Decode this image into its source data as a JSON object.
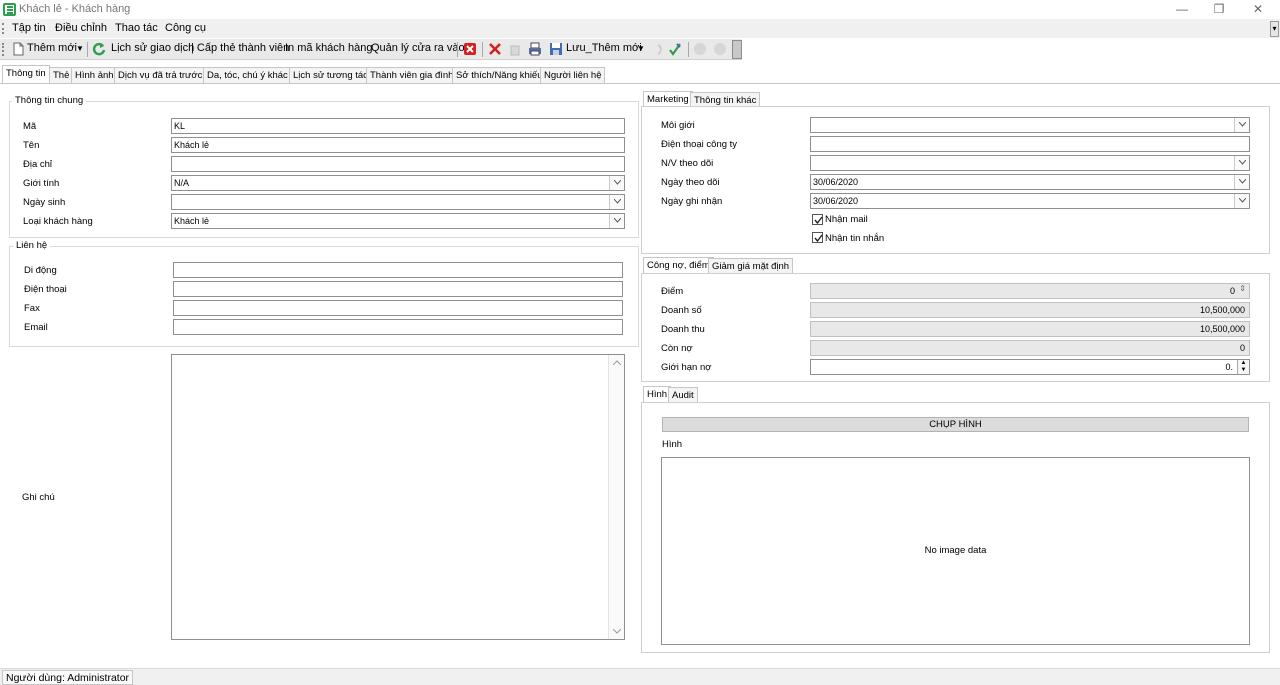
{
  "window": {
    "title": "Khách lẻ - Khách hàng",
    "minimize": "—",
    "restore": "❐",
    "close": "✕"
  },
  "menu": [
    "Tập tin",
    "Điều chỉnh",
    "Thao tác",
    "Công cụ"
  ],
  "toolbar": {
    "new": "Thêm mới",
    "history": "Lịch sử giao dịch",
    "issue_card": "| Cấp thẻ thành viên",
    "print_code": "In mã khách hàng",
    "door_manage": "Quản lý cửa ra vào",
    "save_new": "Lưu_Thêm mới"
  },
  "tabs": [
    "Thông tin",
    "Thẻ",
    "Hình ảnh",
    "Dịch vụ đã trả trước",
    "Da, tóc, chú ý khác",
    "Lịch sử tương tác",
    "Thành viên gia đình",
    "Sở thích/Năng khiếu",
    "Người liên hệ"
  ],
  "general": {
    "title": "Thông tin chung",
    "code_label": "Mã",
    "code": "KL",
    "name_label": "Tên",
    "name": "Khách lẻ",
    "address_label": "Địa chỉ",
    "address": "",
    "gender_label": "Giới tính",
    "gender": "N/A",
    "birth_label": "Ngày sinh",
    "birth": "",
    "type_label": "Loại khách hàng",
    "type": "Khách lẻ"
  },
  "contact": {
    "title": "Liên hệ",
    "mobile_label": "Di động",
    "phone_label": "Điện thoại",
    "fax_label": "Fax",
    "email_label": "Email"
  },
  "note_label": "Ghi chú",
  "marketing": {
    "tabs": [
      "Marketing",
      "Thông tin khác"
    ],
    "broker_label": "Môi giới",
    "company_phone_label": "Điện thoại công ty",
    "staff_label": "N/V theo dõi",
    "follow_date_label": "Ngày theo dõi",
    "follow_date": "30/06/2020",
    "record_date_label": "Ngày ghi nhận",
    "record_date": "30/06/2020",
    "receive_mail": "Nhận mail",
    "receive_sms": "Nhận tin nhắn"
  },
  "debt": {
    "tabs": [
      "Công nợ, điểm",
      "Giảm giá mặt định"
    ],
    "points_label": "Điểm",
    "points": "0",
    "sales_label": "Doanh số",
    "sales": "10,500,000",
    "revenue_label": "Doanh thu",
    "revenue": "10,500,000",
    "remaining_label": "Còn nợ",
    "remaining": "0",
    "limit_label": "Giới hạn nợ",
    "limit": "0."
  },
  "image": {
    "tabs": [
      "Hình",
      "Audit"
    ],
    "capture": "CHỤP HÌNH",
    "label": "Hình",
    "empty": "No image data"
  },
  "status": {
    "user": "Người dùng: Administrator"
  },
  "colors": {
    "accent_green": "#2e9e4f",
    "delete_red": "#d42020",
    "bg": "#f0f0f0"
  }
}
